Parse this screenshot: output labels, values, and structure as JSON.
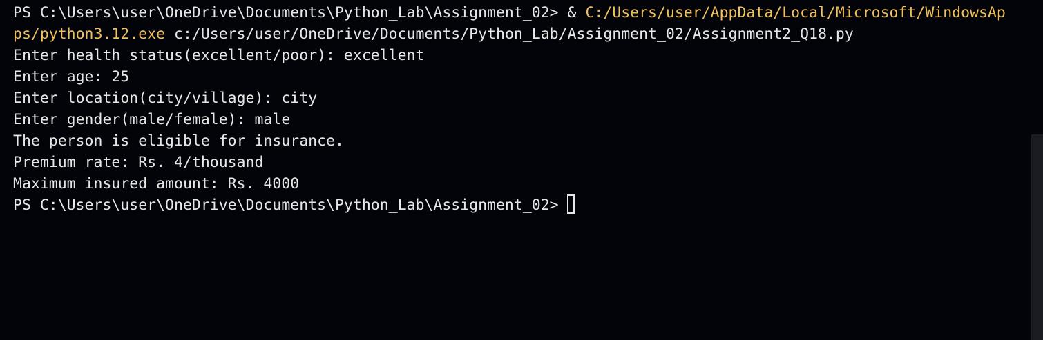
{
  "terminal": {
    "colors": {
      "background": "#020409",
      "text": "#e6e6e6",
      "path": "#f0c05a"
    },
    "command_line": {
      "prompt": "PS C:\\Users\\user\\OneDrive\\Documents\\Python_Lab\\Assignment_02> ",
      "operator": "& ",
      "exe_path_part1": "C:/Users/user/AppData/Local/Microsoft/WindowsAp",
      "exe_path_part2": "ps/python3.12.exe",
      "script_path": " c:/Users/user/OneDrive/Documents/Python_Lab/Assignment_02/Assignment2_Q18.py"
    },
    "output_lines": [
      "Enter health status(excellent/poor): excellent",
      "Enter age: 25",
      "Enter location(city/village): city",
      "Enter gender(male/female): male",
      "The person is eligible for insurance.",
      "Premium rate: Rs. 4/thousand",
      "Maximum insured amount: Rs. 4000"
    ],
    "final_prompt": "PS C:\\Users\\user\\OneDrive\\Documents\\Python_Lab\\Assignment_02>"
  }
}
